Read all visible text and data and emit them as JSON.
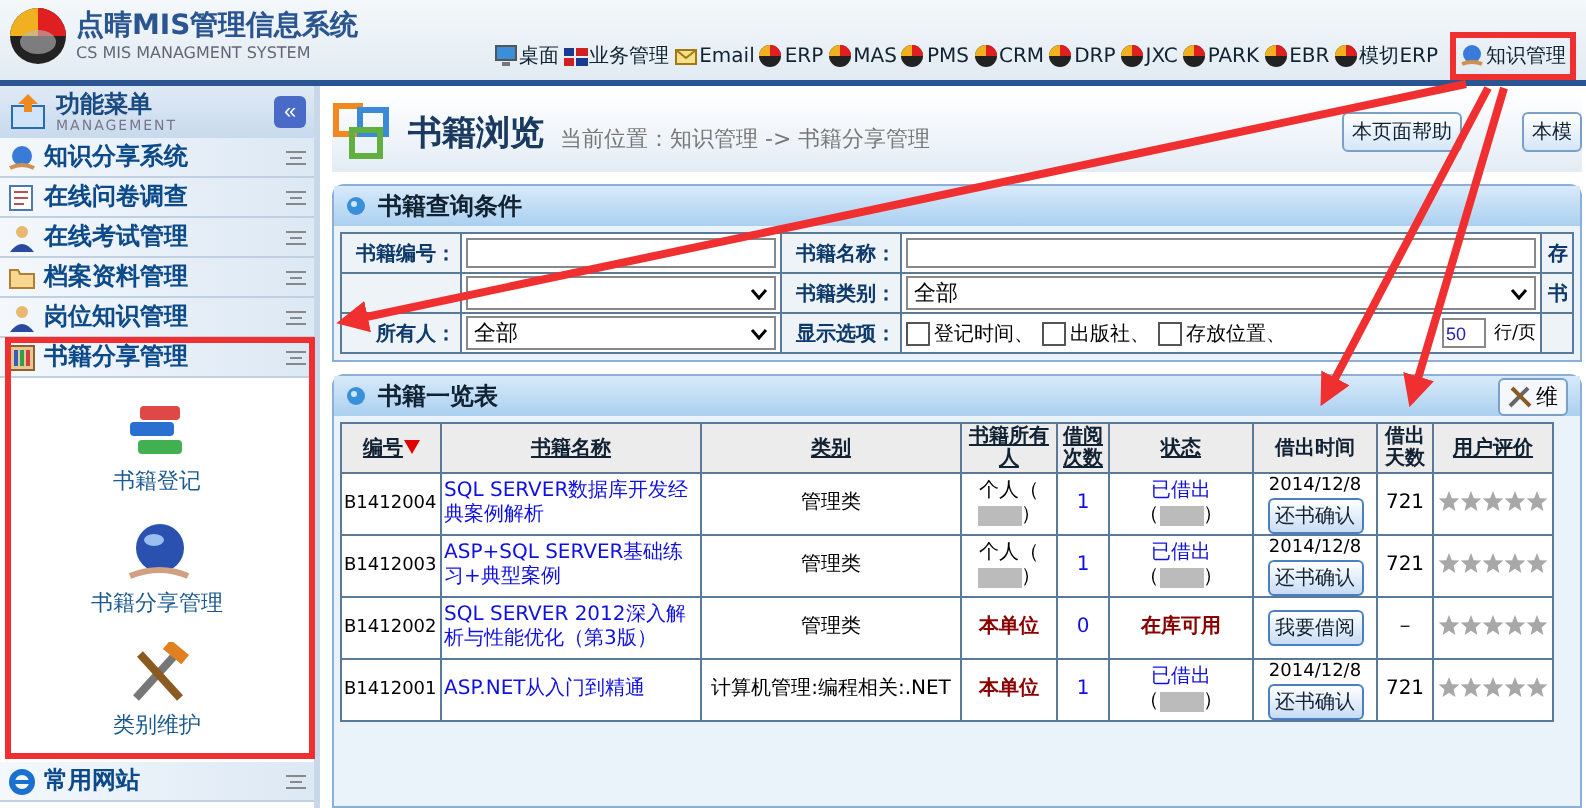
{
  "header": {
    "title": "点晴MIS管理信息系统",
    "subtitle": "CS MIS MANAGMENT SYSTEM",
    "nav": [
      {
        "label": "桌面",
        "kind": "monitor",
        "highlighted": false
      },
      {
        "label": "业务管理",
        "kind": "flag",
        "highlighted": false
      },
      {
        "label": "Email",
        "kind": "mail",
        "highlighted": false
      },
      {
        "label": "ERP",
        "kind": "ball",
        "highlighted": false
      },
      {
        "label": "MAS",
        "kind": "ball",
        "highlighted": false
      },
      {
        "label": "PMS",
        "kind": "ball",
        "highlighted": false
      },
      {
        "label": "CRM",
        "kind": "ball",
        "highlighted": false
      },
      {
        "label": "DRP",
        "kind": "ball",
        "highlighted": false
      },
      {
        "label": "JXC",
        "kind": "ball",
        "highlighted": false
      },
      {
        "label": "PARK",
        "kind": "ball",
        "highlighted": false
      },
      {
        "label": "EBR",
        "kind": "ball",
        "highlighted": false
      },
      {
        "label": "模切ERP",
        "kind": "ball",
        "highlighted": false
      },
      {
        "label": "知识管理",
        "kind": "globe",
        "highlighted": true
      }
    ]
  },
  "sidebar": {
    "title": "功能菜单",
    "subtitle": "MANAGEMENT",
    "collapse": "«",
    "items": [
      {
        "label": "知识分享系统",
        "kind": "globe",
        "expanded": false
      },
      {
        "label": "在线问卷调查",
        "kind": "form",
        "expanded": false
      },
      {
        "label": "在线考试管理",
        "kind": "person",
        "expanded": false
      },
      {
        "label": "档案资料管理",
        "kind": "folder",
        "expanded": false
      },
      {
        "label": "岗位知识管理",
        "kind": "person",
        "expanded": false
      },
      {
        "label": "书籍分享管理",
        "kind": "shelf",
        "expanded": true,
        "children": [
          {
            "label": "书籍登记",
            "kind": "books"
          },
          {
            "label": "书籍分享管理",
            "kind": "globe"
          },
          {
            "label": "类别维护",
            "kind": "tools"
          }
        ]
      },
      {
        "label": "常用网站",
        "kind": "ie",
        "expanded": false
      }
    ]
  },
  "page": {
    "title": "书籍浏览",
    "breadcrumb": "当前位置：知识管理 -> 书籍分享管理",
    "buttons": [
      "本页面帮助",
      "本模"
    ]
  },
  "query": {
    "title": "书籍查询条件",
    "rows": [
      [
        {
          "label": "书籍编号：",
          "kind": "text"
        },
        {
          "label": "书籍名称：",
          "kind": "text"
        },
        {
          "label": "存",
          "kind": "cut"
        }
      ],
      [
        {
          "kind": "select"
        },
        {
          "label": "书籍类别：",
          "kind": "select",
          "value": "全部"
        },
        {
          "label": "书",
          "kind": "cut"
        }
      ],
      [
        {
          "label": "所有人：",
          "kind": "select",
          "value": "全部"
        },
        {
          "label": "显示选项：",
          "kind": "options"
        },
        {
          "kind": "cut"
        }
      ]
    ],
    "options": [
      {
        "label": "登记时间、",
        "checked": false
      },
      {
        "label": "出版社、",
        "checked": false
      },
      {
        "label": "存放位置、",
        "checked": false
      }
    ],
    "page_size": "50",
    "page_size_unit": "行/页"
  },
  "list": {
    "title": "书籍一览表",
    "tool_button": "维",
    "columns": [
      {
        "label": "编号",
        "sorted": true,
        "link": true
      },
      {
        "label": "书籍名称",
        "sorted": false,
        "link": true
      },
      {
        "label": "类别",
        "sorted": false,
        "link": true
      },
      {
        "label": "书籍所有人",
        "sorted": false,
        "link": true
      },
      {
        "label": "借阅次数",
        "sorted": false,
        "link": true
      },
      {
        "label": "状态",
        "sorted": false,
        "link": true
      },
      {
        "label": "借出时间",
        "sorted": false,
        "link": false
      },
      {
        "label": "借出天数",
        "sorted": false,
        "link": false
      },
      {
        "label": "用户评价",
        "sorted": false,
        "link": true
      }
    ],
    "rows": [
      {
        "id": "B1412004",
        "title": "SQL SERVER数据库开发经典案例解析",
        "category": "管理类",
        "owner": {
          "kind": "person",
          "text": "个人（",
          "close": "）"
        },
        "count": "1",
        "status": {
          "kind": "lent",
          "text": "已借出",
          "open": "（",
          "close": "）"
        },
        "date": "2014/12/8",
        "action": "还书确认",
        "days": "721",
        "stars": 0
      },
      {
        "id": "B1412003",
        "title": "ASP+SQL SERVER基础练习+典型案例",
        "category": "管理类",
        "owner": {
          "kind": "person",
          "text": "个人（",
          "close": "）"
        },
        "count": "1",
        "status": {
          "kind": "lent",
          "text": "已借出",
          "open": "（",
          "close": "）"
        },
        "date": "2014/12/8",
        "action": "还书确认",
        "days": "721",
        "stars": 0
      },
      {
        "id": "B1412002",
        "title": "SQL SERVER 2012深入解析与性能优化（第3版）",
        "category": "管理类",
        "owner": {
          "kind": "unit",
          "text": "本单位"
        },
        "count": "0",
        "status": {
          "kind": "available",
          "text": "在库可用"
        },
        "action": "我要借阅",
        "days": "－",
        "stars": 0
      },
      {
        "id": "B1412001",
        "title": "ASP.NET从入门到精通",
        "category": "计算机管理:编程相关:.NET",
        "owner": {
          "kind": "unit",
          "text": "本单位"
        },
        "count": "1",
        "status": {
          "kind": "lent",
          "text": "已借出",
          "open": "（",
          "close": "）"
        },
        "date": "2014/12/8",
        "action": "还书确认",
        "days": "721",
        "stars": 0
      }
    ]
  }
}
